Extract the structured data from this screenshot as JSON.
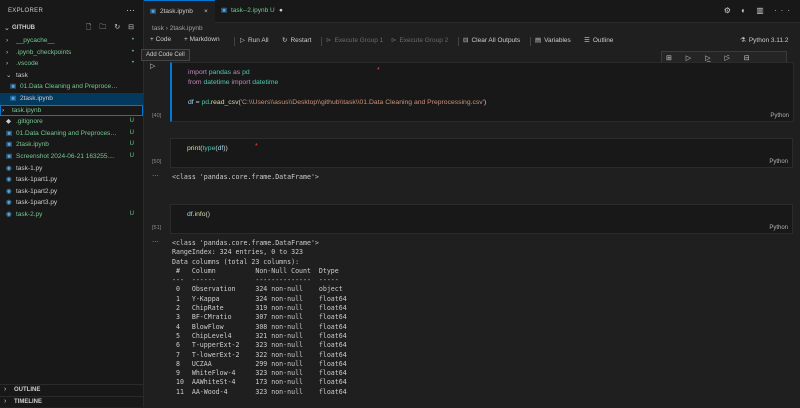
{
  "explorer": {
    "title": "EXPLORER",
    "menu": "···",
    "section": "GITHUB",
    "section_actions": "🗋 🗀 ↻ ⊟",
    "items": [
      {
        "name": "__pycache__",
        "icon": "›",
        "status": "•",
        "color": "#73c991"
      },
      {
        "name": ".ipynb_checkpoints",
        "icon": "›",
        "status": "•",
        "color": "#73c991"
      },
      {
        "name": ".vscode",
        "icon": "›",
        "status": "•",
        "color": "#73c991"
      },
      {
        "name": "task",
        "icon": "⌄",
        "status": "",
        "color": "#cccccc"
      },
      {
        "name": "01.Data Cleaning and Preprocessin...",
        "icon": "▣",
        "status": "",
        "color": "#73c991"
      },
      {
        "name": "2task.ipynb",
        "icon": "▣",
        "status": "",
        "color": "#cccccc"
      },
      {
        "name": "task.ipynb",
        "icon": "›",
        "status": "",
        "color": "#73c991"
      },
      {
        "name": ".gitignore",
        "icon": "◆",
        "status": "U",
        "color": "#73c991"
      },
      {
        "name": "01.Data Cleaning and Preprocessing...",
        "icon": "▣",
        "status": "U",
        "color": "#73c991"
      },
      {
        "name": "2task.ipynb",
        "icon": "▣",
        "status": "U",
        "color": "#73c991"
      },
      {
        "name": "Screenshot 2024-06-21 163255....",
        "icon": "▣",
        "status": "U",
        "color": "#73c991"
      },
      {
        "name": "task-1.py",
        "icon": "◉",
        "status": "",
        "color": "#cccccc"
      },
      {
        "name": "task-1part1.py",
        "icon": "◉",
        "status": "",
        "color": "#cccccc"
      },
      {
        "name": "task-1part2.py",
        "icon": "◉",
        "status": "",
        "color": "#cccccc"
      },
      {
        "name": "task-1part3.py",
        "icon": "◉",
        "status": "",
        "color": "#cccccc"
      },
      {
        "name": "task-2.py",
        "icon": "◉",
        "status": "U",
        "color": "#73c991"
      }
    ],
    "outline": "OUTLINE",
    "timeline": "TIMELINE"
  },
  "tabs": [
    {
      "label": "2task.ipynb",
      "close": "×"
    },
    {
      "label": "task--2.ipynb",
      "status": "U",
      "dirty": "●"
    }
  ],
  "top_icons": "⚙ ◐ ▥ ···",
  "breadcrumb": "task  ›  ▣ 2task.ipynb  ›  ▣ + Code  + Markdown  ⋯",
  "toolbar": {
    "code": "+ Code",
    "markdown": "+ Markdown",
    "run_all": "Run All",
    "restart": "Restart",
    "execute_group_1": "Execute Group 1",
    "execute_group_2": "Execute Group 2",
    "clear_outputs": "Clear All Outputs",
    "variables": "Variables",
    "outline": "Outline",
    "kernel": "Python 3.11.2"
  },
  "tooltip": "Add Code Cell",
  "cell_toolbar": "⊞ ▷ ▷̲ ▷̄ ⊟ ··· 🗑",
  "cells": [
    {
      "exec": "[40]",
      "lang": "Python",
      "lines": [
        "import pandas as pd",
        "from datetime import datetime",
        "",
        "df = pd.read_csv('C:\\\\Users\\\\asus\\\\Desktop\\\\github\\\\task\\\\01.Data Cleaning and Preprocessing.csv')"
      ]
    },
    {
      "exec": "[50]",
      "lang": "Python",
      "lines": [
        "print(type(df))"
      ]
    },
    {
      "exec": "[51]",
      "lang": "Python",
      "lines": [
        "df.info()"
      ]
    }
  ],
  "outputs": {
    "out1": "<class 'pandas.core.frame.DataFrame'>",
    "out2_lines": [
      "<class 'pandas.core.frame.DataFrame'>",
      "RangeIndex: 324 entries, 0 to 323",
      "Data columns (total 23 columns):",
      " #   Column          Non-Null Count  Dtype",
      "---  ------          --------------  -----",
      " 0   Observation     324 non-null    object",
      " 1   Y-Kappa         324 non-null    float64",
      " 2   ChipRate        319 non-null    float64",
      " 3   BF-CMratio      307 non-null    float64",
      " 4   BlowFlow        308 non-null    float64",
      " 5   ChipLevel4      321 non-null    float64",
      " 6   T-upperExt-2    323 non-null    float64",
      " 7   T-lowerExt-2    322 non-null    float64",
      " 8   UCZAA           299 non-null    float64",
      " 9   WhiteFlow-4     323 non-null    float64",
      " 10  AAWhiteSt-4     173 non-null    float64",
      " 11  AA-Wood-4       323 non-null    float64"
    ],
    "gutter": "⋯"
  },
  "colors": {
    "accent": "#0078d4",
    "untracked": "#73c991",
    "modified_dot": "#f14c4c"
  }
}
